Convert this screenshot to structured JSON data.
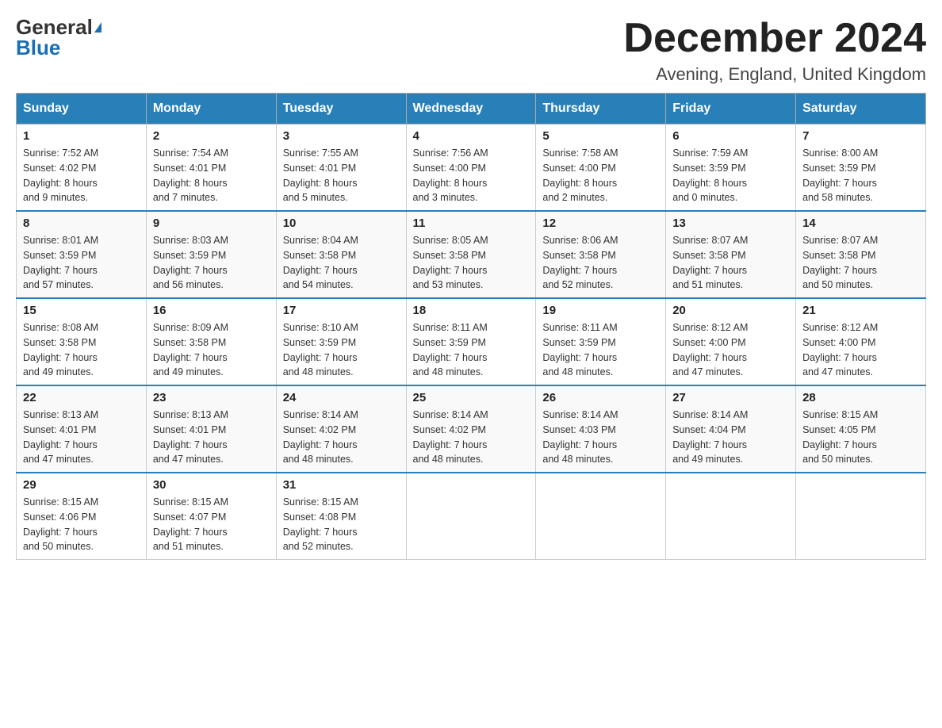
{
  "logo": {
    "general": "General",
    "blue": "Blue",
    "arrow_char": "▶"
  },
  "header": {
    "month_year": "December 2024",
    "location": "Avening, England, United Kingdom"
  },
  "weekdays": [
    "Sunday",
    "Monday",
    "Tuesday",
    "Wednesday",
    "Thursday",
    "Friday",
    "Saturday"
  ],
  "weeks": [
    [
      {
        "day": "1",
        "sunrise": "7:52 AM",
        "sunset": "4:02 PM",
        "daylight": "8 hours and 9 minutes."
      },
      {
        "day": "2",
        "sunrise": "7:54 AM",
        "sunset": "4:01 PM",
        "daylight": "8 hours and 7 minutes."
      },
      {
        "day": "3",
        "sunrise": "7:55 AM",
        "sunset": "4:01 PM",
        "daylight": "8 hours and 5 minutes."
      },
      {
        "day": "4",
        "sunrise": "7:56 AM",
        "sunset": "4:00 PM",
        "daylight": "8 hours and 3 minutes."
      },
      {
        "day": "5",
        "sunrise": "7:58 AM",
        "sunset": "4:00 PM",
        "daylight": "8 hours and 2 minutes."
      },
      {
        "day": "6",
        "sunrise": "7:59 AM",
        "sunset": "3:59 PM",
        "daylight": "8 hours and 0 minutes."
      },
      {
        "day": "7",
        "sunrise": "8:00 AM",
        "sunset": "3:59 PM",
        "daylight": "7 hours and 58 minutes."
      }
    ],
    [
      {
        "day": "8",
        "sunrise": "8:01 AM",
        "sunset": "3:59 PM",
        "daylight": "7 hours and 57 minutes."
      },
      {
        "day": "9",
        "sunrise": "8:03 AM",
        "sunset": "3:59 PM",
        "daylight": "7 hours and 56 minutes."
      },
      {
        "day": "10",
        "sunrise": "8:04 AM",
        "sunset": "3:58 PM",
        "daylight": "7 hours and 54 minutes."
      },
      {
        "day": "11",
        "sunrise": "8:05 AM",
        "sunset": "3:58 PM",
        "daylight": "7 hours and 53 minutes."
      },
      {
        "day": "12",
        "sunrise": "8:06 AM",
        "sunset": "3:58 PM",
        "daylight": "7 hours and 52 minutes."
      },
      {
        "day": "13",
        "sunrise": "8:07 AM",
        "sunset": "3:58 PM",
        "daylight": "7 hours and 51 minutes."
      },
      {
        "day": "14",
        "sunrise": "8:07 AM",
        "sunset": "3:58 PM",
        "daylight": "7 hours and 50 minutes."
      }
    ],
    [
      {
        "day": "15",
        "sunrise": "8:08 AM",
        "sunset": "3:58 PM",
        "daylight": "7 hours and 49 minutes."
      },
      {
        "day": "16",
        "sunrise": "8:09 AM",
        "sunset": "3:58 PM",
        "daylight": "7 hours and 49 minutes."
      },
      {
        "day": "17",
        "sunrise": "8:10 AM",
        "sunset": "3:59 PM",
        "daylight": "7 hours and 48 minutes."
      },
      {
        "day": "18",
        "sunrise": "8:11 AM",
        "sunset": "3:59 PM",
        "daylight": "7 hours and 48 minutes."
      },
      {
        "day": "19",
        "sunrise": "8:11 AM",
        "sunset": "3:59 PM",
        "daylight": "7 hours and 48 minutes."
      },
      {
        "day": "20",
        "sunrise": "8:12 AM",
        "sunset": "4:00 PM",
        "daylight": "7 hours and 47 minutes."
      },
      {
        "day": "21",
        "sunrise": "8:12 AM",
        "sunset": "4:00 PM",
        "daylight": "7 hours and 47 minutes."
      }
    ],
    [
      {
        "day": "22",
        "sunrise": "8:13 AM",
        "sunset": "4:01 PM",
        "daylight": "7 hours and 47 minutes."
      },
      {
        "day": "23",
        "sunrise": "8:13 AM",
        "sunset": "4:01 PM",
        "daylight": "7 hours and 47 minutes."
      },
      {
        "day": "24",
        "sunrise": "8:14 AM",
        "sunset": "4:02 PM",
        "daylight": "7 hours and 48 minutes."
      },
      {
        "day": "25",
        "sunrise": "8:14 AM",
        "sunset": "4:02 PM",
        "daylight": "7 hours and 48 minutes."
      },
      {
        "day": "26",
        "sunrise": "8:14 AM",
        "sunset": "4:03 PM",
        "daylight": "7 hours and 48 minutes."
      },
      {
        "day": "27",
        "sunrise": "8:14 AM",
        "sunset": "4:04 PM",
        "daylight": "7 hours and 49 minutes."
      },
      {
        "day": "28",
        "sunrise": "8:15 AM",
        "sunset": "4:05 PM",
        "daylight": "7 hours and 50 minutes."
      }
    ],
    [
      {
        "day": "29",
        "sunrise": "8:15 AM",
        "sunset": "4:06 PM",
        "daylight": "7 hours and 50 minutes."
      },
      {
        "day": "30",
        "sunrise": "8:15 AM",
        "sunset": "4:07 PM",
        "daylight": "7 hours and 51 minutes."
      },
      {
        "day": "31",
        "sunrise": "8:15 AM",
        "sunset": "4:08 PM",
        "daylight": "7 hours and 52 minutes."
      },
      null,
      null,
      null,
      null
    ]
  ]
}
